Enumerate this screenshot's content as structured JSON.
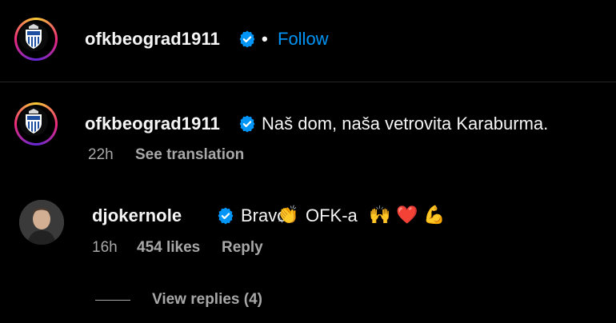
{
  "header": {
    "username": "ofkbeograd1911",
    "separator": "•",
    "follow_label": "Follow"
  },
  "caption": {
    "username": "ofkbeograd1911",
    "text": "Naš dom, naša vetrovita Karaburma.",
    "time": "22h",
    "see_translation": "See translation"
  },
  "comment": {
    "username": "djokernole",
    "text_part1": "Bravo",
    "emoji_clap": "👏",
    "text_part2": "OFK-a",
    "emoji_hands": "🙌",
    "emoji_heart": "❤️",
    "emoji_muscle": "💪",
    "time": "16h",
    "likes": "454 likes",
    "reply_label": "Reply",
    "view_replies": "View replies (4)"
  },
  "colors": {
    "background": "#000000",
    "text": "#f5f5f5",
    "secondary": "#a8a8a8",
    "link": "#0095f6",
    "verified": "#0095f6"
  },
  "icons": [
    "club-crest-icon",
    "verified-badge-icon",
    "heart-icon"
  ]
}
